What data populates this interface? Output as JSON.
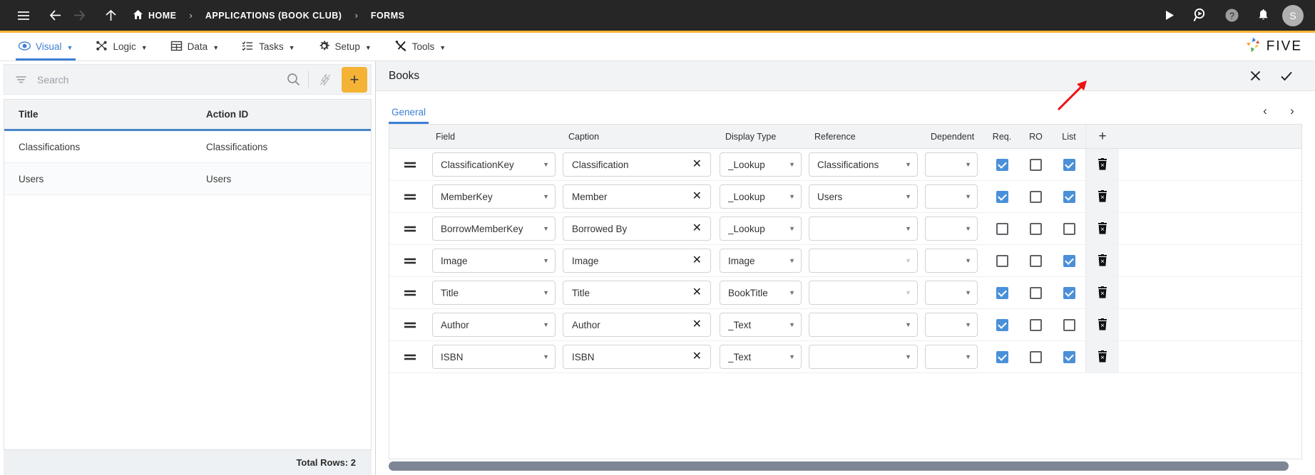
{
  "topbar": {
    "icons": [
      "hamburger-menu",
      "back-arrow",
      "forward-arrow",
      "up-arrow"
    ],
    "breadcrumbs": [
      {
        "label": "HOME",
        "icon": "home-icon"
      },
      {
        "label": "APPLICATIONS (BOOK CLUB)",
        "icon": ""
      },
      {
        "label": "FORMS",
        "icon": ""
      }
    ],
    "separator": "›",
    "right_icons": [
      "play-icon",
      "search-run-icon",
      "help-icon",
      "bell-icon"
    ],
    "avatar_initial": "S",
    "accent_color": "#f5b335",
    "background": "#262626"
  },
  "menubar": {
    "items": [
      {
        "label": "Visual",
        "icon": "eye-icon",
        "active": true,
        "caret": "▼"
      },
      {
        "label": "Logic",
        "icon": "logic-nodes-icon",
        "active": false,
        "caret": "▼"
      },
      {
        "label": "Data",
        "icon": "table-grid-icon",
        "active": false,
        "caret": "▼"
      },
      {
        "label": "Tasks",
        "icon": "checklist-icon",
        "active": false,
        "caret": "▼"
      },
      {
        "label": "Setup",
        "icon": "gear-icon",
        "active": false,
        "caret": "▼"
      },
      {
        "label": "Tools",
        "icon": "tools-icon",
        "active": false,
        "caret": "▼"
      }
    ],
    "logo_text": "FIVE",
    "active_color": "#3d7fd4"
  },
  "left_pane": {
    "search": {
      "placeholder": "Search",
      "value": "",
      "filter_icon": "filter-icon",
      "search_icon": "search-icon",
      "bolt_icon": "lightning-bolt-icon"
    },
    "add_button_label": "+",
    "columns": [
      "Title",
      "Action ID"
    ],
    "rows": [
      {
        "title": "Classifications",
        "action_id": "Classifications"
      },
      {
        "title": "Users",
        "action_id": "Users"
      }
    ],
    "footer": "Total Rows: 2"
  },
  "right_pane": {
    "title": "Books",
    "close_icon": "close-x-icon",
    "save_icon": "checkmark-icon",
    "tabs": [
      {
        "label": "General",
        "active": true
      }
    ],
    "pager": {
      "prev": "‹",
      "next": "›"
    },
    "grid": {
      "columns": [
        "Field",
        "Caption",
        "Display Type",
        "Reference",
        "Dependent",
        "Req.",
        "RO",
        "List"
      ],
      "add_column_label": "+",
      "rows": [
        {
          "drag": "drag-handle-icon",
          "field": "ClassificationKey",
          "caption": "Classification",
          "display_type": "_Lookup",
          "reference": "Classifications",
          "reference_enabled": true,
          "dependent": "",
          "req": true,
          "ro": false,
          "list": true,
          "delete_icon": "delete-row-icon"
        },
        {
          "drag": "drag-handle-icon",
          "field": "MemberKey",
          "caption": "Member",
          "display_type": "_Lookup",
          "reference": "Users",
          "reference_enabled": true,
          "dependent": "",
          "req": true,
          "ro": false,
          "list": true,
          "delete_icon": "delete-row-icon"
        },
        {
          "drag": "drag-handle-icon",
          "field": "BorrowMemberKey",
          "caption": "Borrowed By",
          "display_type": "_Lookup",
          "reference": "",
          "reference_enabled": true,
          "dependent": "",
          "req": false,
          "ro": false,
          "list": false,
          "delete_icon": "delete-row-icon"
        },
        {
          "drag": "drag-handle-icon",
          "field": "Image",
          "caption": "Image",
          "display_type": "Image",
          "reference": "",
          "reference_enabled": false,
          "dependent": "",
          "req": false,
          "ro": false,
          "list": true,
          "delete_icon": "delete-row-icon"
        },
        {
          "drag": "drag-handle-icon",
          "field": "Title",
          "caption": "Title",
          "display_type": "BookTitle",
          "reference": "",
          "reference_enabled": false,
          "dependent": "",
          "req": true,
          "ro": false,
          "list": true,
          "delete_icon": "delete-row-icon"
        },
        {
          "drag": "drag-handle-icon",
          "field": "Author",
          "caption": "Author",
          "display_type": "_Text",
          "reference": "",
          "reference_enabled": true,
          "dependent": "",
          "req": true,
          "ro": false,
          "list": false,
          "delete_icon": "delete-row-icon"
        },
        {
          "drag": "drag-handle-icon",
          "field": "ISBN",
          "caption": "ISBN",
          "display_type": "_Text",
          "reference": "",
          "reference_enabled": true,
          "dependent": "",
          "req": true,
          "ro": false,
          "list": true,
          "delete_icon": "delete-row-icon"
        }
      ],
      "caption_clear_icon": "clear-x-icon"
    },
    "scrollbar": "horizontal-scrollbar"
  },
  "annotation": {
    "type": "red-arrow",
    "points_to": "checkmark-icon",
    "color": "#ee1111"
  }
}
